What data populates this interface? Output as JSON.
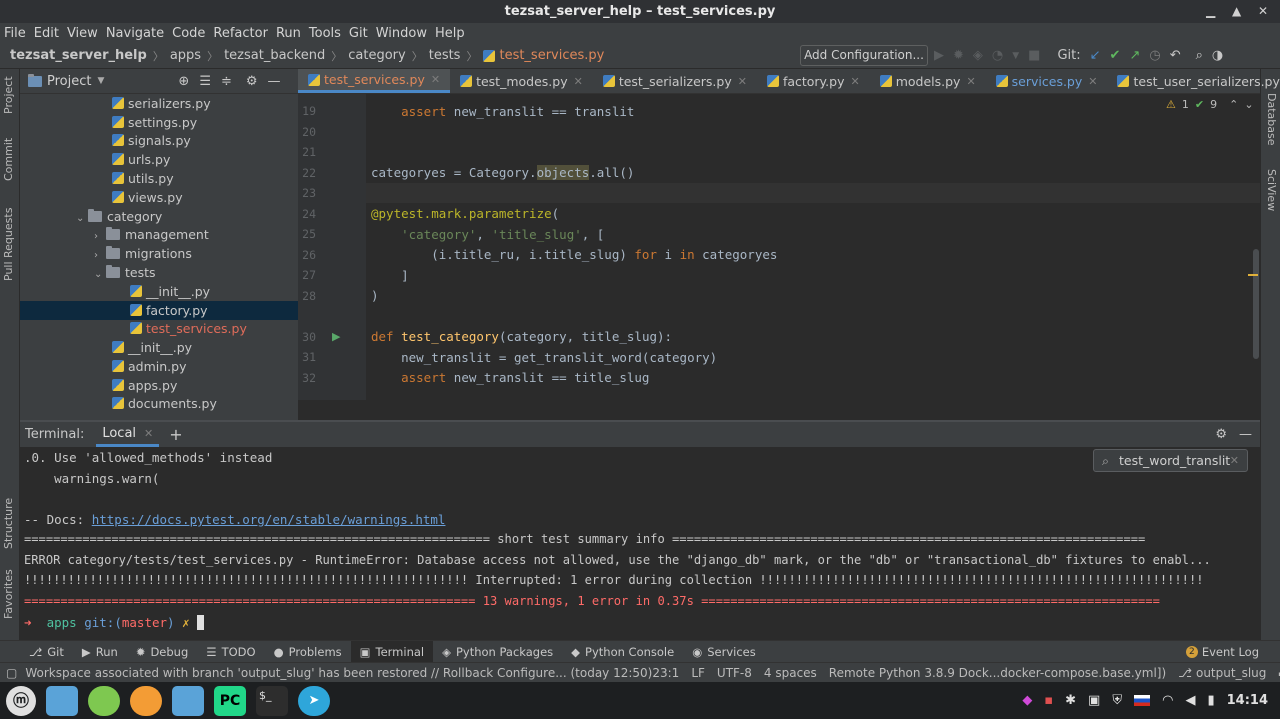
{
  "window": {
    "title": "tezsat_server_help – test_services.py"
  },
  "menu": [
    "File",
    "Edit",
    "View",
    "Navigate",
    "Code",
    "Refactor",
    "Run",
    "Tools",
    "Git",
    "Window",
    "Help"
  ],
  "breadcrumb": [
    "tezsat_server_help",
    "apps",
    "tezsat_backend",
    "category",
    "tests",
    "test_services.py"
  ],
  "toolbar": {
    "add_config": "Add Configuration...",
    "git_label": "Git:"
  },
  "left_strip": [
    "Project",
    "Commit",
    "Pull Requests",
    "Structure",
    "Favorites"
  ],
  "right_strip": [
    "Database",
    "SciView"
  ],
  "project": {
    "title": "Project",
    "tree": [
      {
        "label": "serializers.py",
        "type": "py"
      },
      {
        "label": "settings.py",
        "type": "py"
      },
      {
        "label": "signals.py",
        "type": "py"
      },
      {
        "label": "urls.py",
        "type": "py"
      },
      {
        "label": "utils.py",
        "type": "py"
      },
      {
        "label": "views.py",
        "type": "py"
      },
      {
        "label": "category",
        "type": "folder",
        "arrow": "open"
      },
      {
        "label": "management",
        "type": "folder",
        "arrow": "closed"
      },
      {
        "label": "migrations",
        "type": "folder",
        "arrow": "closed"
      },
      {
        "label": "tests",
        "type": "folder",
        "arrow": "open"
      },
      {
        "label": "__init__.py",
        "type": "py"
      },
      {
        "label": "factory.py",
        "type": "py"
      },
      {
        "label": "test_services.py",
        "type": "py"
      },
      {
        "label": "__init__.py",
        "type": "py"
      },
      {
        "label": "admin.py",
        "type": "py"
      },
      {
        "label": "apps.py",
        "type": "py"
      },
      {
        "label": "documents.py",
        "type": "py"
      }
    ]
  },
  "tabs": [
    "test_services.py",
    "test_modes.py",
    "test_serializers.py",
    "factory.py",
    "models.py",
    "services.py",
    "test_user_serializers.py"
  ],
  "editor": {
    "inspections": {
      "warnings": "1",
      "ok": "9"
    },
    "lines": [
      {
        "n": "19",
        "text": "    assert new_translit == translit"
      },
      {
        "n": "20",
        "text": ""
      },
      {
        "n": "21",
        "text": ""
      },
      {
        "n": "22",
        "text": "categoryes = Category.objects.all()"
      },
      {
        "n": "23",
        "text": ""
      },
      {
        "n": "24",
        "text": "@pytest.mark.parametrize("
      },
      {
        "n": "25",
        "text": "    'category', 'title_slug', ["
      },
      {
        "n": "26",
        "text": "        (i.title_ru, i.title_slug) for i in categoryes"
      },
      {
        "n": "27",
        "text": "    ]"
      },
      {
        "n": "28",
        "text": ")"
      },
      {
        "n": "29",
        "text": ""
      },
      {
        "n": "30",
        "text": "def test_category(category, title_slug):"
      },
      {
        "n": "31",
        "text": "    new_translit = get_translit_word(category)"
      },
      {
        "n": "32",
        "text": "    assert new_translit == title_slug"
      }
    ]
  },
  "terminal": {
    "label": "Terminal:",
    "tab": "Local",
    "search": "test_word_translit",
    "lines": [
      ".0. Use 'allowed_methods' instead",
      "    warnings.warn(",
      "",
      "-- Docs: https://docs.pytest.org/en/stable/warnings.html",
      "================================================================ short test summary info =================================================================",
      "ERROR category/tests/test_services.py - RuntimeError: Database access not allowed, use the \"django_db\" mark, or the \"db\" or \"transactional_db\" fixtures to enabl...",
      "!!!!!!!!!!!!!!!!!!!!!!!!!!!!!!!!!!!!!!!!!!!!!!!!!!!!!!!!!!!!! Interrupted: 1 error during collection !!!!!!!!!!!!!!!!!!!!!!!!!!!!!!!!!!!!!!!!!!!!!!!!!!!!!!!!!!!!!",
      "============================================================== 13 warnings, 1 error in 0.37s ==============================================================="
    ],
    "prompt": {
      "arrow": "➜",
      "dir": "apps",
      "git": "git:(",
      "branch": "master",
      ")": ")",
      "mark": "✗"
    }
  },
  "tool_windows": [
    "Git",
    "Run",
    "Debug",
    "TODO",
    "Problems",
    "Terminal",
    "Python Packages",
    "Python Console",
    "Services"
  ],
  "event_log": {
    "count": "2",
    "label": "Event Log"
  },
  "status": {
    "message": "Workspace associated with branch 'output_slug' has been restored // Rollback   Configure... (today 12:50)",
    "pos": "23:1",
    "lf": "LF",
    "enc": "UTF-8",
    "indent": "4 spaces",
    "interp": "Remote Python 3.8.9 Dock...docker-compose.base.yml])",
    "branch": "output_slug"
  },
  "clock": "14:14",
  "colors": {
    "accent": "#4a88c7",
    "error": "#ff6b68",
    "prompt": "#4fc1a0",
    "branch": "#ff6b68"
  }
}
